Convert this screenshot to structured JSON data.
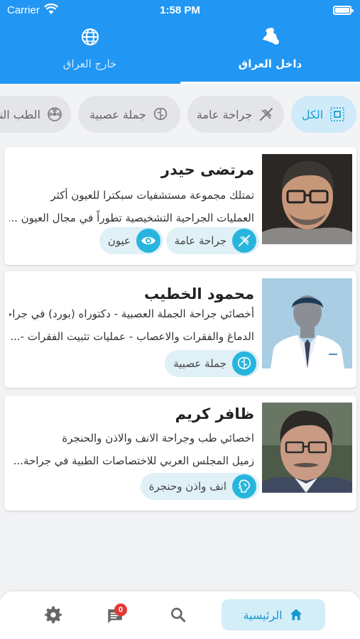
{
  "status_bar": {
    "carrier": "Carrier",
    "time": "1:58 PM"
  },
  "tabs": {
    "inside": {
      "label": "داخل العراق",
      "icon": "iraq-map-icon",
      "selected": true
    },
    "outside": {
      "label": "خارج العراق",
      "icon": "globe-icon",
      "selected": false
    }
  },
  "categories": [
    {
      "label": "الكل",
      "icon": "grid-icon",
      "active": true
    },
    {
      "label": "جراحة عامة",
      "icon": "scalpel-icon",
      "active": false
    },
    {
      "label": "جملة عصبية",
      "icon": "brain-icon",
      "active": false
    },
    {
      "label": "الطب النووي",
      "icon": "radiation-icon",
      "active": false
    }
  ],
  "doctors": [
    {
      "name": "مرتضى حيدر",
      "line1": "تمتلك مجموعة مستشفيات سبكترا للعيون أكثر",
      "line2": "العمليات الجراحية التشخيصية تطوراً في مجال العيون ...",
      "tags": [
        {
          "label": "جراحة عامة",
          "icon": "scalpel-icon"
        },
        {
          "label": "عيون",
          "icon": "eye-icon"
        }
      ]
    },
    {
      "name": "محمود الخطيب",
      "line1": "أخصائي جراحة الجملة العصبية - دكتوراه (بورد) في جراحة",
      "line2": "الدماغ والفقرات والاعصاب - عمليات تثبيت الفقرات -...",
      "tags": [
        {
          "label": "جملة عصبية",
          "icon": "brain-icon"
        }
      ]
    },
    {
      "name": "ظافر كريم",
      "line1": "اخصائي طب وجراحة الانف والاذن والحنجرة",
      "line2": "زميل المجلس العربي للاختصاصات الطبية في جراحة...",
      "tags": [
        {
          "label": "انف واذن وحنجرة",
          "icon": "ent-icon"
        }
      ]
    }
  ],
  "bottom_nav": {
    "home_label": "الرئيسية",
    "notification_count": "0"
  },
  "colors": {
    "primary": "#2196f3",
    "accent": "#27b5dd",
    "chip_active_bg": "#cfeaf8"
  }
}
